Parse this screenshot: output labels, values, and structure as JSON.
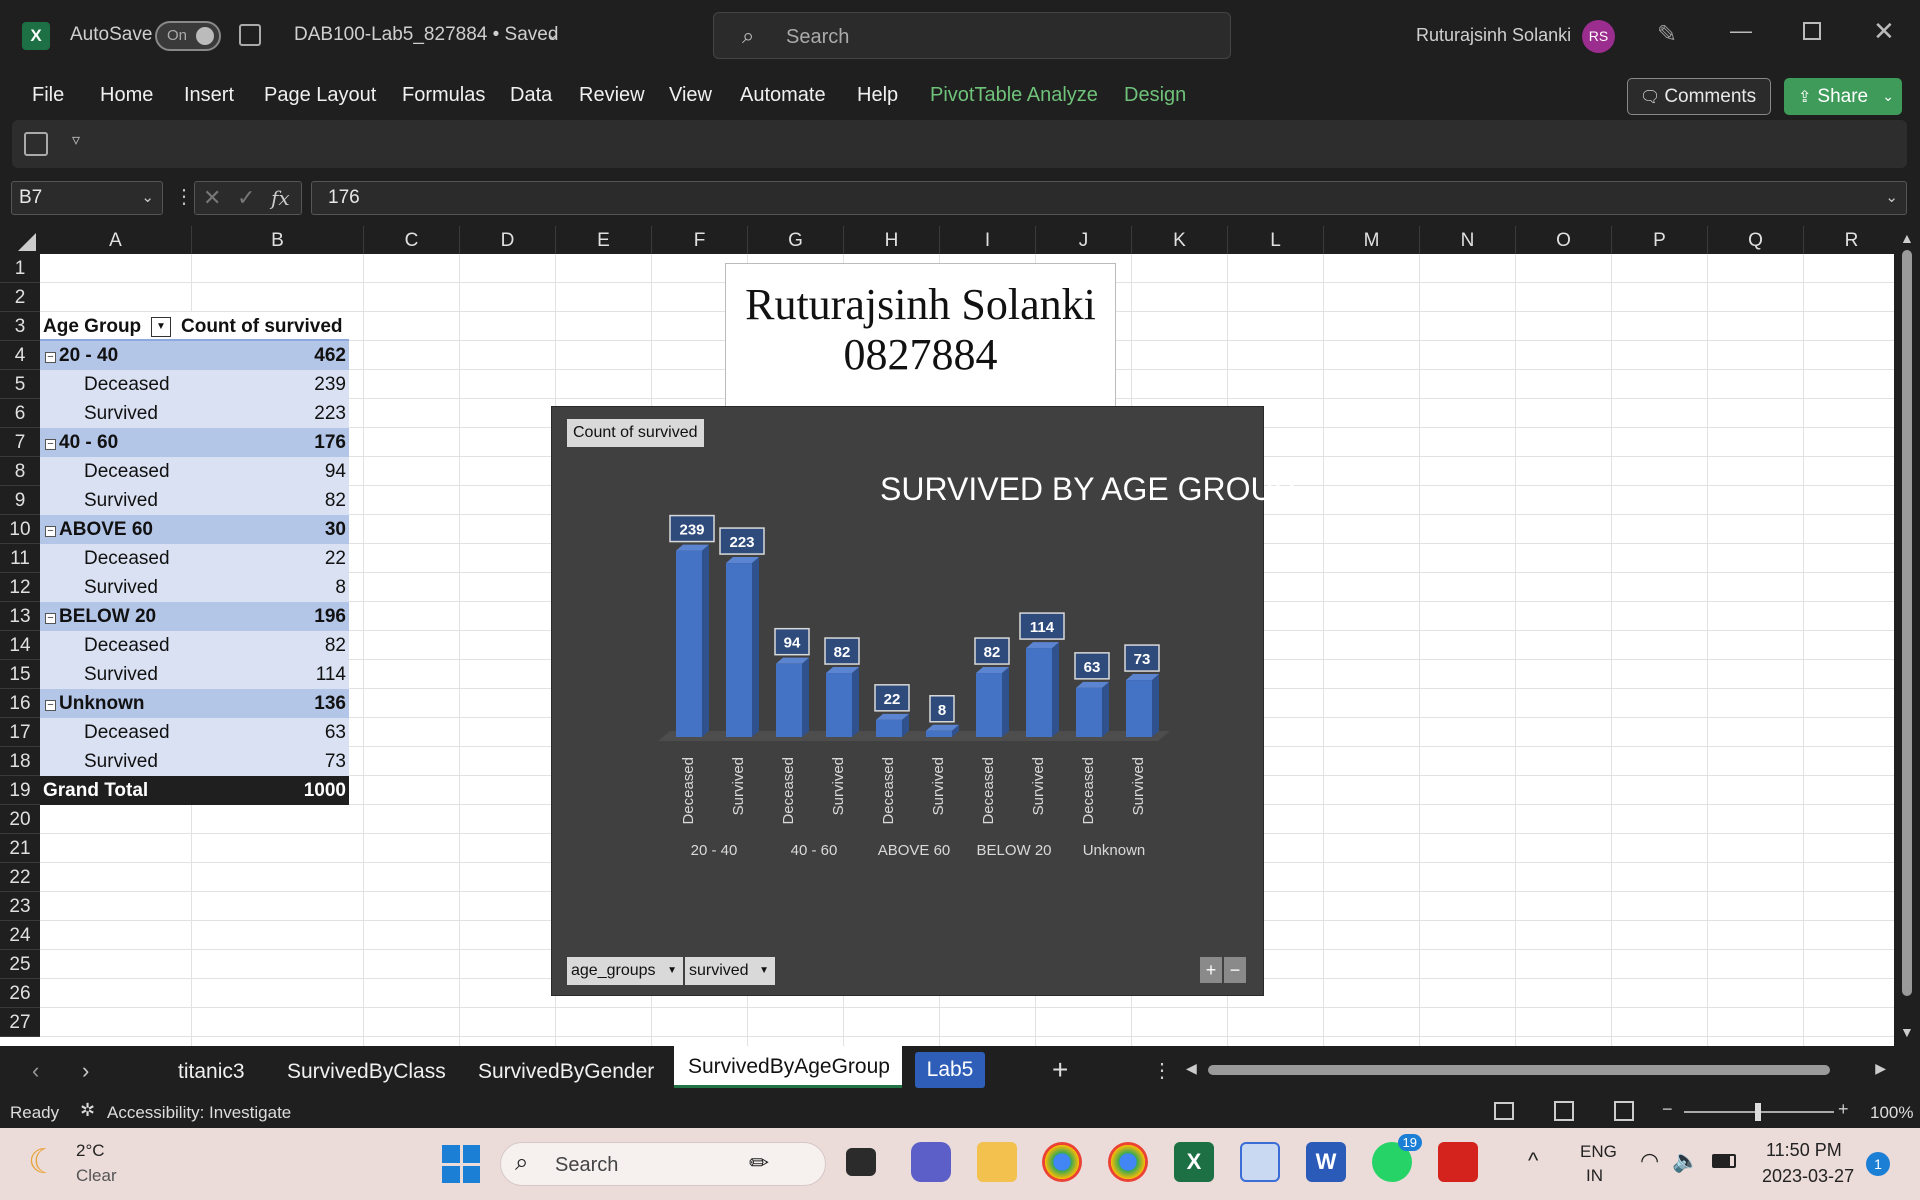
{
  "titlebar": {
    "autosave_label": "AutoSave",
    "autosave_state": "On",
    "file_name": "DAB100-Lab5_827884 • Saved",
    "search_placeholder": "Search",
    "user_name": "Ruturajsinh Solanki",
    "user_initials": "RS"
  },
  "ribbon": {
    "tabs": [
      "File",
      "Home",
      "Insert",
      "Page Layout",
      "Formulas",
      "Data",
      "Review",
      "View",
      "Automate",
      "Help",
      "PivotTable Analyze",
      "Design"
    ],
    "comments_label": "Comments",
    "share_label": "Share"
  },
  "formula_bar": {
    "name_box": "B7",
    "fx": "fx",
    "value": "176"
  },
  "columns": [
    "A",
    "B",
    "C",
    "D",
    "E",
    "F",
    "G",
    "H",
    "I",
    "J",
    "K",
    "L",
    "M",
    "N",
    "O",
    "P",
    "Q",
    "R"
  ],
  "rows": [
    "1",
    "2",
    "3",
    "4",
    "5",
    "6",
    "7",
    "8",
    "9",
    "10",
    "11",
    "12",
    "13",
    "14",
    "15",
    "16",
    "17",
    "18",
    "19",
    "20",
    "21",
    "22",
    "23",
    "24",
    "25",
    "26",
    "27"
  ],
  "pivot": {
    "header_label": "Age Group",
    "header_value": "Count of survived",
    "rows": [
      {
        "kind": "group",
        "label": "20 - 40",
        "value": "462"
      },
      {
        "kind": "item",
        "label": "Deceased",
        "value": "239"
      },
      {
        "kind": "item",
        "label": "Survived",
        "value": "223"
      },
      {
        "kind": "group",
        "label": "40 - 60",
        "value": "176"
      },
      {
        "kind": "item",
        "label": "Deceased",
        "value": "94"
      },
      {
        "kind": "item",
        "label": "Survived",
        "value": "82"
      },
      {
        "kind": "group",
        "label": "ABOVE 60",
        "value": "30"
      },
      {
        "kind": "item",
        "label": "Deceased",
        "value": "22"
      },
      {
        "kind": "item",
        "label": "Survived",
        "value": "8"
      },
      {
        "kind": "group",
        "label": "BELOW 20",
        "value": "196"
      },
      {
        "kind": "item",
        "label": "Deceased",
        "value": "82"
      },
      {
        "kind": "item",
        "label": "Survived",
        "value": "114"
      },
      {
        "kind": "group",
        "label": "Unknown",
        "value": "136"
      },
      {
        "kind": "item",
        "label": "Deceased",
        "value": "63"
      },
      {
        "kind": "item",
        "label": "Survived",
        "value": "73"
      }
    ],
    "total_label": "Grand Total",
    "total_value": "1000"
  },
  "textbox": {
    "line1": "Ruturajsinh Solanki",
    "line2": "0827884"
  },
  "chart_data": {
    "type": "bar",
    "title": "SURVIVED BY AGE GROUP",
    "value_field_button": "Count of survived",
    "axis_field_buttons": [
      "age_groups",
      "survived"
    ],
    "groups": [
      "20 - 40",
      "40 - 60",
      "ABOVE 60",
      "BELOW 20",
      "Unknown"
    ],
    "categories": [
      "Deceased",
      "Survived",
      "Deceased",
      "Survived",
      "Deceased",
      "Survived",
      "Deceased",
      "Survived",
      "Deceased",
      "Survived"
    ],
    "values": [
      239,
      223,
      94,
      82,
      22,
      8,
      82,
      114,
      63,
      73
    ],
    "ylim": [
      0,
      250
    ],
    "grid": false,
    "legend": "none",
    "bar_color": "#4472c4",
    "background": "#404040"
  },
  "sheets": [
    "titanic3",
    "SurvivedByClass",
    "SurvivedByGender",
    "SurvivedByAgeGroup",
    "Lab5"
  ],
  "active_sheet": "SurvivedByAgeGroup",
  "status": {
    "ready": "Ready",
    "accessibility": "Accessibility: Investigate",
    "zoom": "100%"
  },
  "taskbar": {
    "weather_temp": "2°C",
    "weather_desc": "Clear",
    "search_placeholder": "Search",
    "lang1": "ENG",
    "lang2": "IN",
    "time": "11:50 PM",
    "date": "2023-03-27",
    "whatsapp_badge": "19",
    "notif_count": "1"
  }
}
